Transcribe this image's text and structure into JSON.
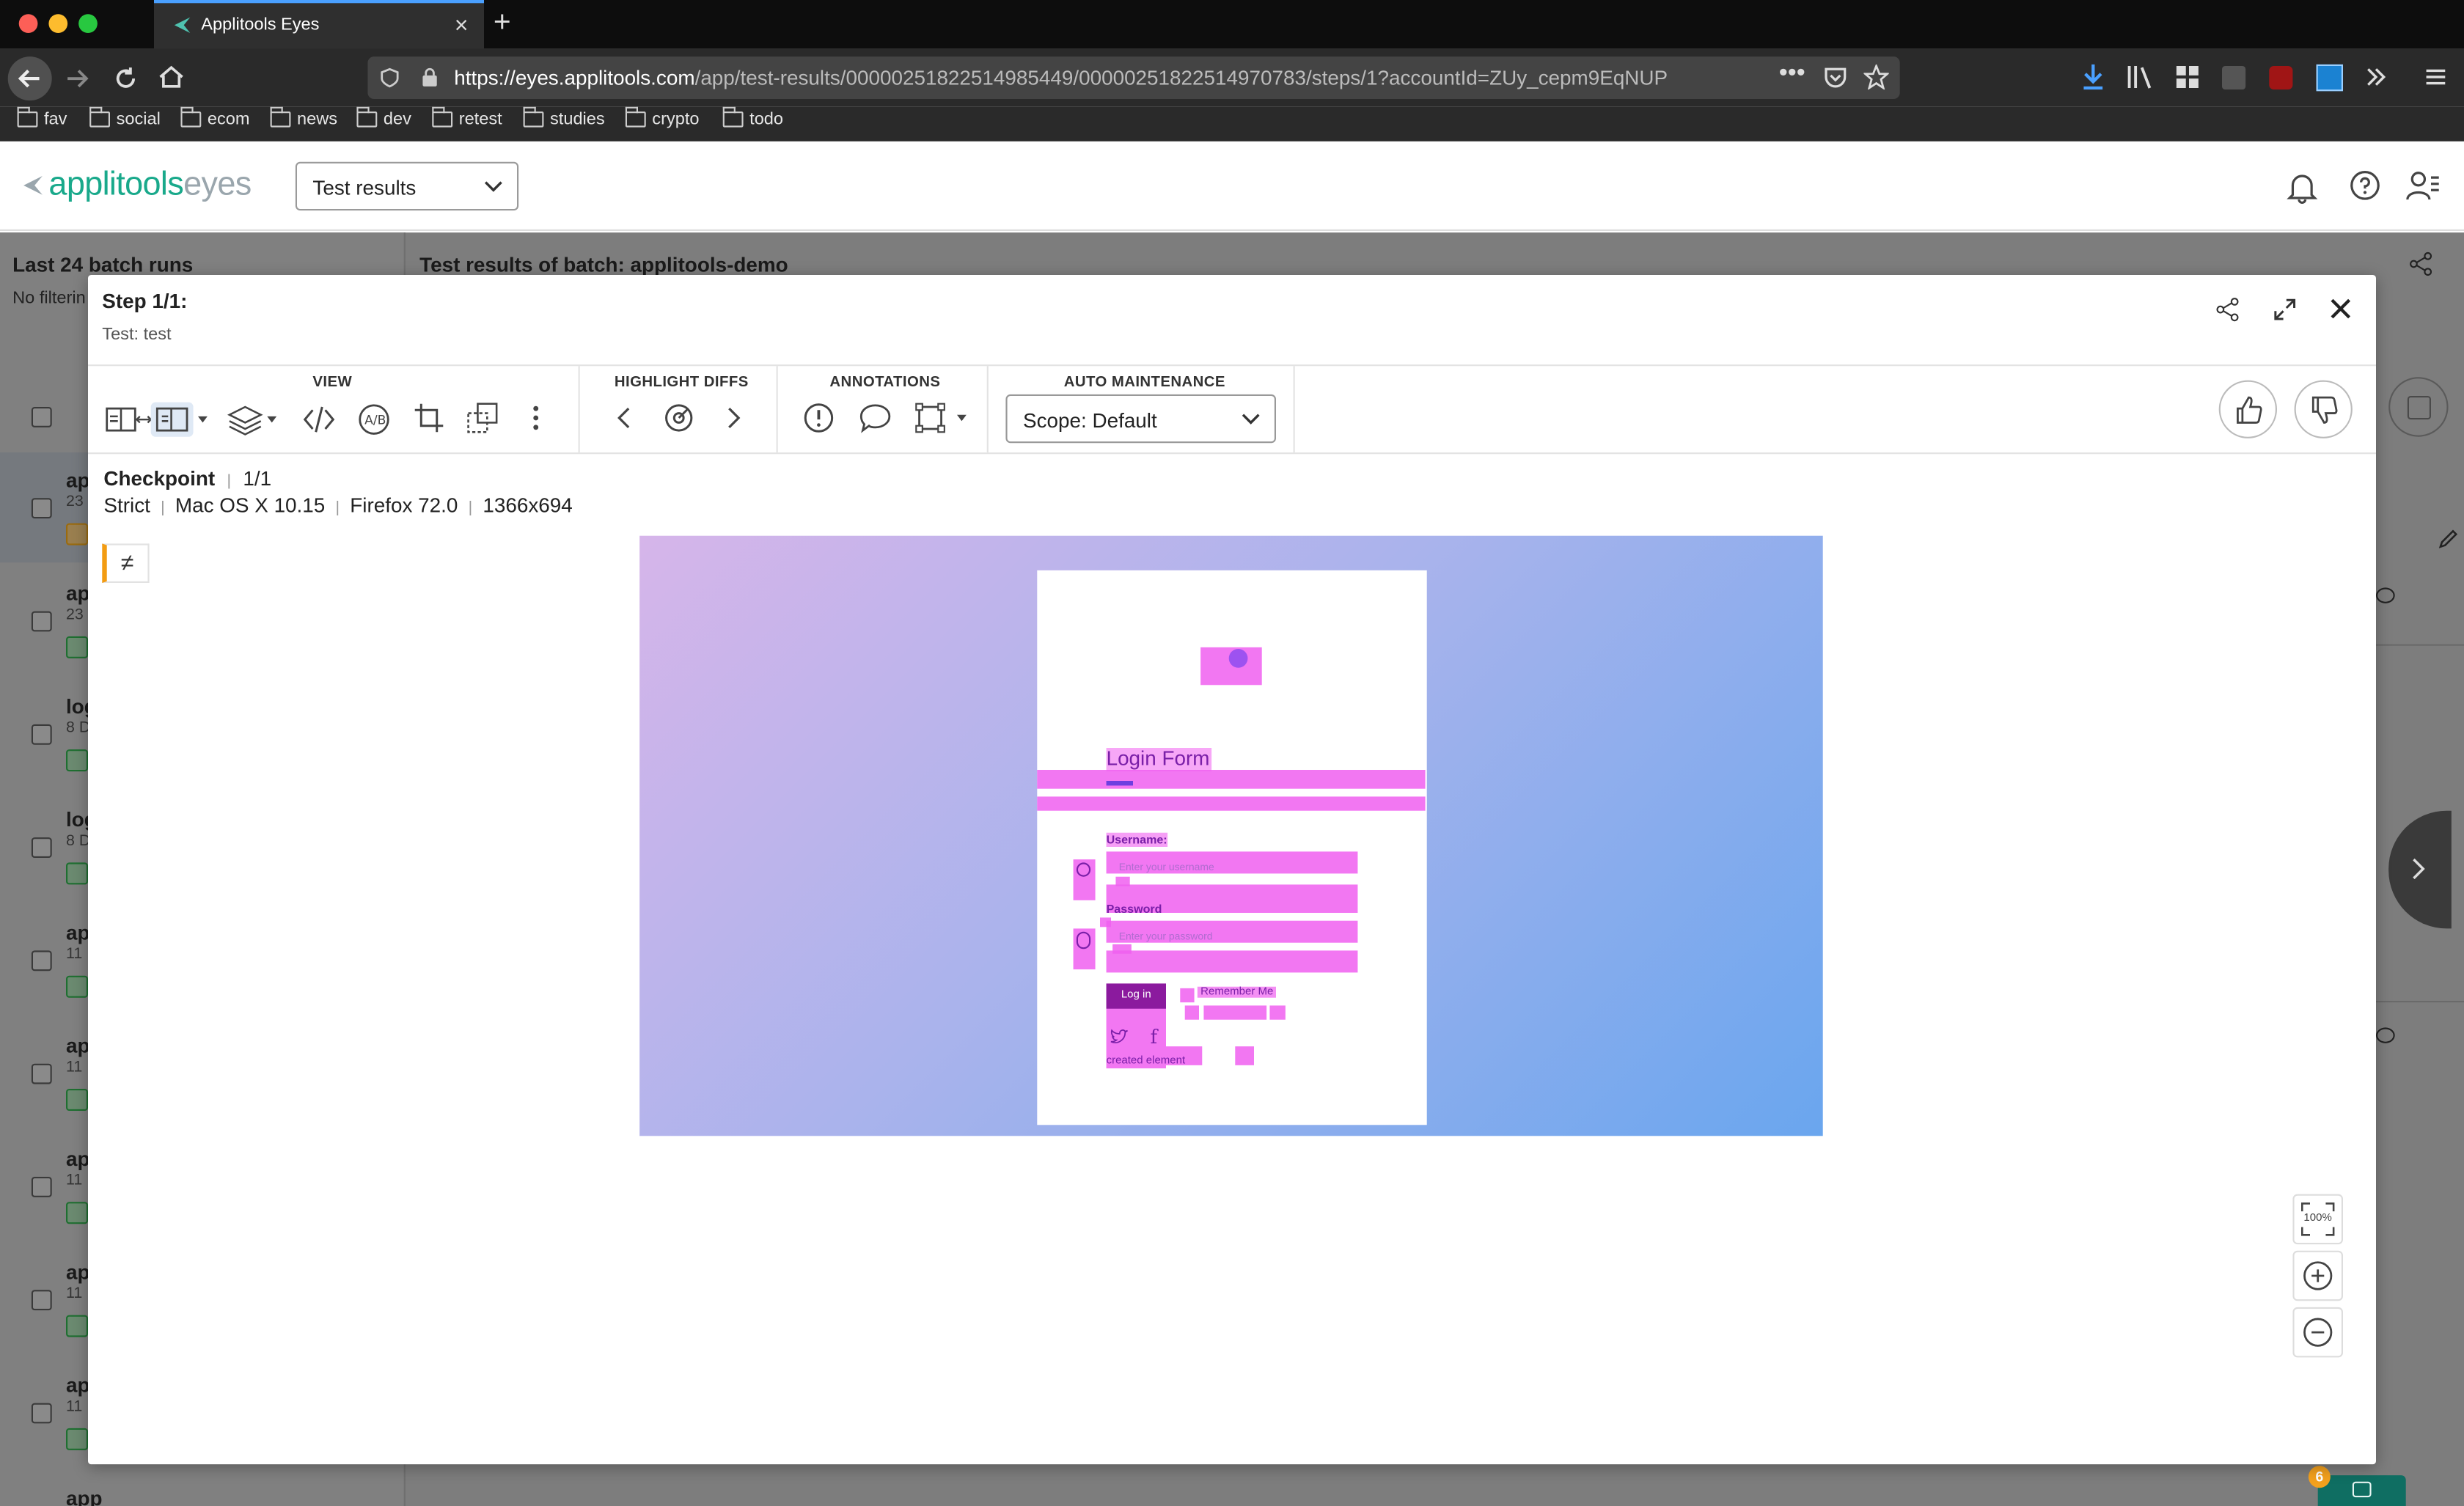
{
  "browser": {
    "tab_title": "Applitools Eyes",
    "url_domain": "https://eyes.applitools.com",
    "url_path": "/app/test-results/00000251822514985449/00000251822514970783/steps/1?accountId=ZUy_cepm9EqNUP",
    "bookmarks": [
      "fav",
      "social",
      "ecom",
      "news",
      "dev",
      "retest",
      "studies",
      "crypto",
      "todo"
    ]
  },
  "app": {
    "logo_main": "applitools",
    "logo_sub": "eyes",
    "section_select": "Test results"
  },
  "background_page": {
    "left_title": "Last 24 batch runs",
    "left_filter": "No filterin",
    "right_title": "Test results of batch: applitools-demo",
    "rows": [
      {
        "title": "ap",
        "sub": "23"
      },
      {
        "title": "ap",
        "sub": "23"
      },
      {
        "title": "log",
        "sub": "8 D"
      },
      {
        "title": "log",
        "sub": "8 D"
      },
      {
        "title": "ap",
        "sub": "11"
      },
      {
        "title": "ap",
        "sub": "11"
      },
      {
        "title": "ap",
        "sub": "11"
      },
      {
        "title": "ap",
        "sub": "11"
      },
      {
        "title": "ap",
        "sub": "11"
      },
      {
        "title": "app",
        "sub": ""
      }
    ],
    "chat_count": "6"
  },
  "modal": {
    "step_title": "Step 1/1:",
    "test_label": "Test: test",
    "toolbar": {
      "view_label": "VIEW",
      "highlight_label": "HIGHLIGHT DIFFS",
      "annotations_label": "ANNOTATIONS",
      "auto_label": "AUTO MAINTENANCE",
      "scope_value": "Scope: Default"
    },
    "checkpoint": {
      "label": "Checkpoint",
      "index": "1/1",
      "match_level": "Strict",
      "os": "Mac OS X 10.15",
      "browser": "Firefox 72.0",
      "viewport": "1366x694"
    },
    "diff_symbol": "≠",
    "zoom_100": "100%"
  },
  "screenshot": {
    "form_title": "Login Form",
    "username_label": "Username:",
    "username_placeholder": "Enter your username",
    "password_label": "Password",
    "password_placeholder": "Enter your password",
    "login_button": "Log in",
    "remember_label": "Remember Me",
    "created_element": "created element"
  }
}
